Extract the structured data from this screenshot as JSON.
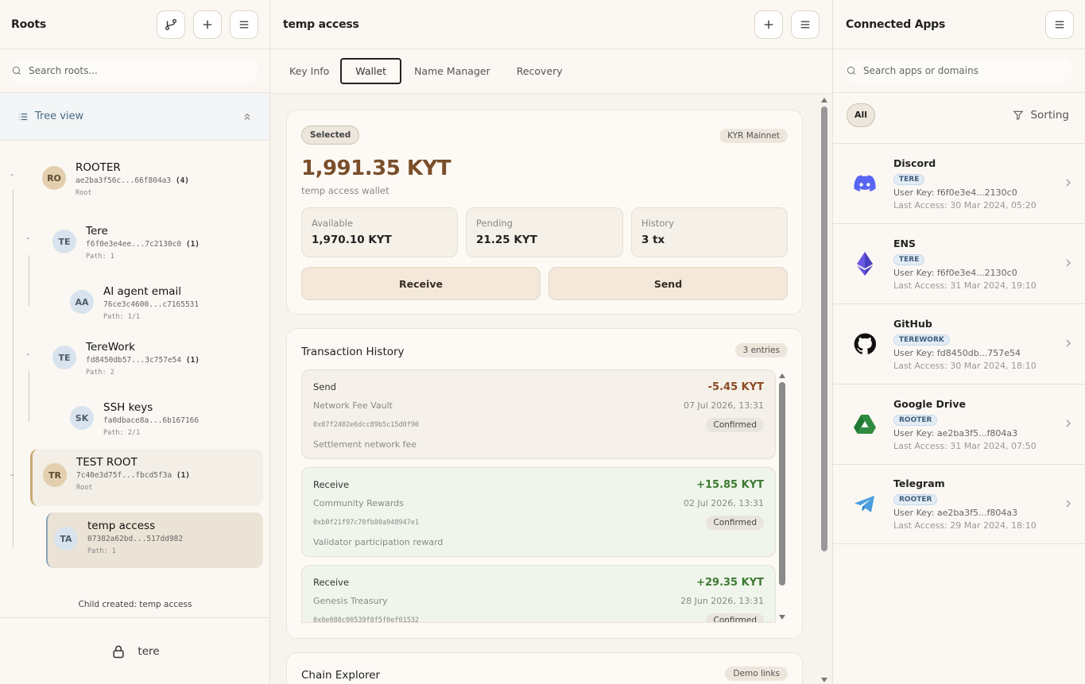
{
  "left": {
    "title": "Roots",
    "search_placeholder": "Search roots...",
    "tree_view_label": "Tree view",
    "nodes": [
      {
        "initials": "RO",
        "name": "ROOTER",
        "key": "ae2ba3f56c...66f804a3",
        "count": "(4)",
        "path": "Root"
      },
      {
        "initials": "TE",
        "name": "Tere",
        "key": "f6f0e3e4ee...7c2130c0",
        "count": "(1)",
        "path": "Path: 1"
      },
      {
        "initials": "AA",
        "name": "AI agent email",
        "key": "76ce3c4600...c7165531",
        "count": "",
        "path": "Path: 1/1"
      },
      {
        "initials": "TE",
        "name": "TereWork",
        "key": "fd8450db57...3c757e54",
        "count": "(1)",
        "path": "Path: 2"
      },
      {
        "initials": "SK",
        "name": "SSH keys",
        "key": "fa0dbace8a...6b167166",
        "count": "",
        "path": "Path: 2/1"
      },
      {
        "initials": "TR",
        "name": "TEST ROOT",
        "key": "7c40e3d75f...fbcd5f3a",
        "count": "(1)",
        "path": "Root"
      },
      {
        "initials": "TA",
        "name": "temp access",
        "key": "07382a62bd...517dd982",
        "count": "",
        "path": "Path: 1"
      }
    ],
    "status_message": "Child created: temp access",
    "user": "tere"
  },
  "center": {
    "title": "temp access",
    "tabs": [
      "Key Info",
      "Wallet",
      "Name Manager",
      "Recovery"
    ],
    "wallet": {
      "selected_label": "Selected",
      "network": "KYR Mainnet",
      "balance": "1,991.35 KYT",
      "wallet_label": "temp access wallet",
      "stats": [
        {
          "k": "Available",
          "v": "1,970.10 KYT"
        },
        {
          "k": "Pending",
          "v": "21.25 KYT"
        },
        {
          "k": "History",
          "v": "3 tx"
        }
      ],
      "receive_label": "Receive",
      "send_label": "Send"
    },
    "history": {
      "title": "Transaction History",
      "count": "3 entries",
      "entries": [
        {
          "type": "Send",
          "amount": "-5.45 KYT",
          "party": "Network Fee Vault",
          "date": "07 Jul 2026, 13:31",
          "hash": "0x07f2402e6dcc89b5c15d0f90",
          "status": "Confirmed",
          "memo": "Settlement network fee"
        },
        {
          "type": "Receive",
          "amount": "+15.85 KYT",
          "party": "Community Rewards",
          "date": "02 Jul 2026, 13:31",
          "hash": "0xb0f21f97c70fb80a948947e1",
          "status": "Confirmed",
          "memo": "Validator participation reward"
        },
        {
          "type": "Receive",
          "amount": "+29.35 KYT",
          "party": "Genesis Treasury",
          "date": "28 Jun 2026, 13:31",
          "hash": "0x0e080c00539f8f5f0ef01532",
          "status": "Confirmed",
          "memo": ""
        }
      ]
    },
    "explorer": {
      "title": "Chain Explorer",
      "badge": "Demo links"
    }
  },
  "right": {
    "title": "Connected Apps",
    "search_placeholder": "Search apps or domains",
    "filter_all": "All",
    "sorting": "Sorting",
    "apps": [
      {
        "name": "Discord",
        "tag": "TERE",
        "user_key": "User Key: f6f0e3e4...2130c0",
        "last_access": "Last Access: 30 Mar 2024, 05:20",
        "icon": "discord-icon"
      },
      {
        "name": "ENS",
        "tag": "TERE",
        "user_key": "User Key: f6f0e3e4...2130c0",
        "last_access": "Last Access: 31 Mar 2024, 19:10",
        "icon": "ethereum-icon"
      },
      {
        "name": "GitHub",
        "tag": "TEREWORK",
        "user_key": "User Key: fd8450db...757e54",
        "last_access": "Last Access: 30 Mar 2024, 18:10",
        "icon": "github-icon"
      },
      {
        "name": "Google Drive",
        "tag": "ROOTER",
        "user_key": "User Key: ae2ba3f5...f804a3",
        "last_access": "Last Access: 31 Mar 2024, 07:50",
        "icon": "google-drive-icon"
      },
      {
        "name": "Telegram",
        "tag": "ROOTER",
        "user_key": "User Key: ae2ba3f5...f804a3",
        "last_access": "Last Access: 29 Mar 2024, 18:10",
        "icon": "telegram-icon"
      }
    ]
  },
  "colors": {
    "accent": "#7a4f2a",
    "positive": "#3b7a30",
    "tag_blue": "#3f5d7c",
    "selected_node": "#ebe3d5"
  }
}
